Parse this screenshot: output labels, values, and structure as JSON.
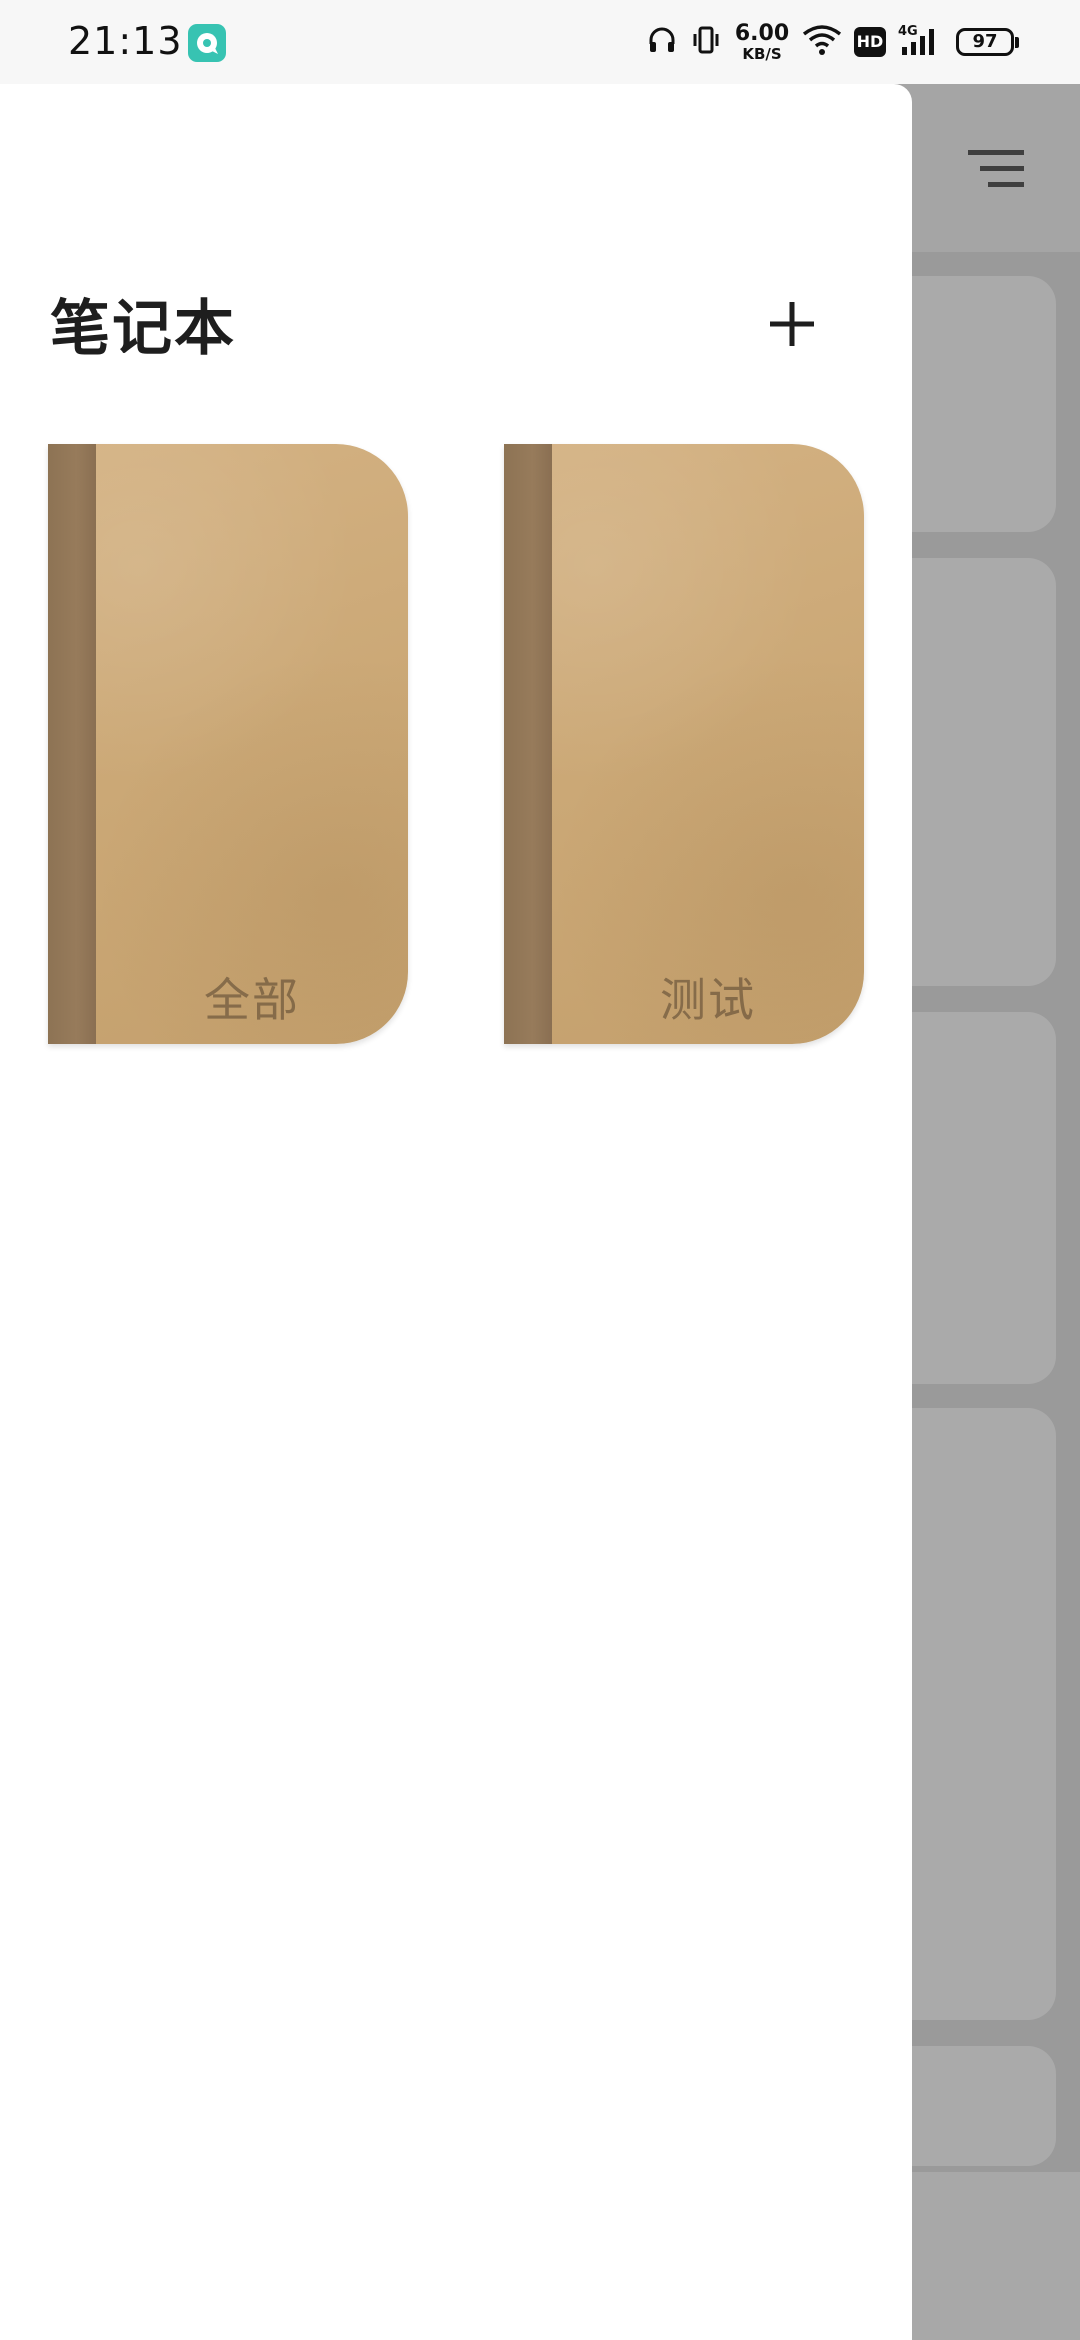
{
  "status_bar": {
    "time": "21:13",
    "net_speed_value": "6.00",
    "net_speed_unit": "KB/S",
    "hd_badge": "HD",
    "network_type": "4G",
    "battery": "97",
    "icons": [
      "app-notification-icon",
      "headphones-icon",
      "vibrate-icon",
      "wifi-icon",
      "hd-icon",
      "cellular-signal-icon",
      "battery-icon"
    ]
  },
  "drawer": {
    "title": "笔记本",
    "add_icon": "plus-icon",
    "notebooks": [
      {
        "label": "全部"
      },
      {
        "label": "测试"
      }
    ]
  },
  "background": {
    "menu_icon": "menu-icon"
  },
  "colors": {
    "notebook_cover": "#cba876",
    "notebook_spine": "#8d7354",
    "status_app_icon": "#37c3b2",
    "scrim": "#9a9a9a"
  }
}
